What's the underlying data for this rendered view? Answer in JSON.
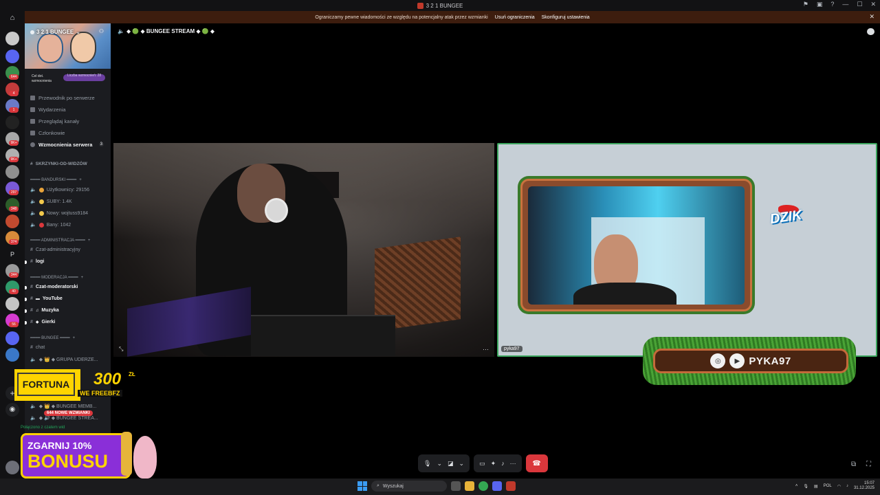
{
  "window": {
    "title": "3 2 1 BUNGEE",
    "controls": [
      "—",
      "☐",
      "✕"
    ]
  },
  "notice": {
    "text": "Ograniczamy pewne wiadomości ze względu na potencjalny atak przez wzmianki",
    "link1": "Usuń ograniczenia",
    "link2": "Skonfiguruj ustawienia",
    "close": "✕"
  },
  "server_rail": {
    "badges": [
      "644",
      "4",
      "1",
      "1",
      "1",
      "9K+",
      "9K+",
      "1",
      "297",
      "348",
      "1",
      "374",
      "344",
      "40",
      "1",
      "56"
    ],
    "letter": "P"
  },
  "sidebar": {
    "server_name": "3 2 1 BUNGEE",
    "boost_goal": "Cel dot. wzmocnienia",
    "boost_count": "Liczba wzmocnień: 28",
    "nav": [
      {
        "label": "Przewodnik po serwerze"
      },
      {
        "label": "Wydarzenia"
      },
      {
        "label": "Przeglądaj kanały"
      },
      {
        "label": "Członkowie"
      },
      {
        "label": "Wzmocnienia serwera",
        "count": "3"
      }
    ],
    "skrzynki": "SKRZYNKI-OD-WIDZÓW",
    "cat_bandurski": "━━━━ BANDURSKI ━━━━",
    "stats": [
      {
        "label": "Użytkownicy: 29156",
        "color": "#e8a33a"
      },
      {
        "label": "SUBY: 1.4K",
        "color": "#f2c94c"
      },
      {
        "label": "Nowy: wojtuss9184",
        "color": "#f2c94c"
      },
      {
        "label": "Bany: 1042",
        "color": "#da373c"
      }
    ],
    "cat_admin": "━━━━ ADMINISTRACJA ━━━━",
    "czat_admin": "Czat-administracyjny",
    "logi": "logi",
    "cat_mod": "━━━━ MODERACJA ━━━━",
    "czat_mod": "Czat-moderatorski",
    "youtube": "YouTube",
    "muzyka": "Muzyka",
    "gierki": "Gierki",
    "cat_bungee": "━━━━ BUNGEE ━━━━",
    "chat": "chat",
    "grupa": "◆ 👑 ◆ GRUPA UDERZE...",
    "bungee_memb": "◆ 👑 ◆ BUNGEE MEMB...",
    "bungee_strea": "◆ 🔊 ◆ BUNGEE STREA...",
    "mentions_badge": "644 NOWE WZMIANKI",
    "connected": "Połączono z czatem wid"
  },
  "stage": {
    "title": "◆ 🟢 ◆ BUNGEE STREAM ◆ 🟢 ◆",
    "tile1_more": "···",
    "tile2_user": "pyka97",
    "dzik": "DZIK",
    "social_handle": "PYKA97"
  },
  "ads": {
    "fortuna_logo": "FORTUNA",
    "fortuna_amount": "300",
    "fortuna_currency": "ZŁ",
    "fortuna_sub": "WE FREEBFZ",
    "bonus_line1": "ZGARNIJ 10%",
    "bonus_line2": "BONUSU"
  },
  "taskbar": {
    "search_placeholder": "Wyszukaj",
    "lang": "POL",
    "time": "15:07",
    "date": "31.12.2025"
  }
}
